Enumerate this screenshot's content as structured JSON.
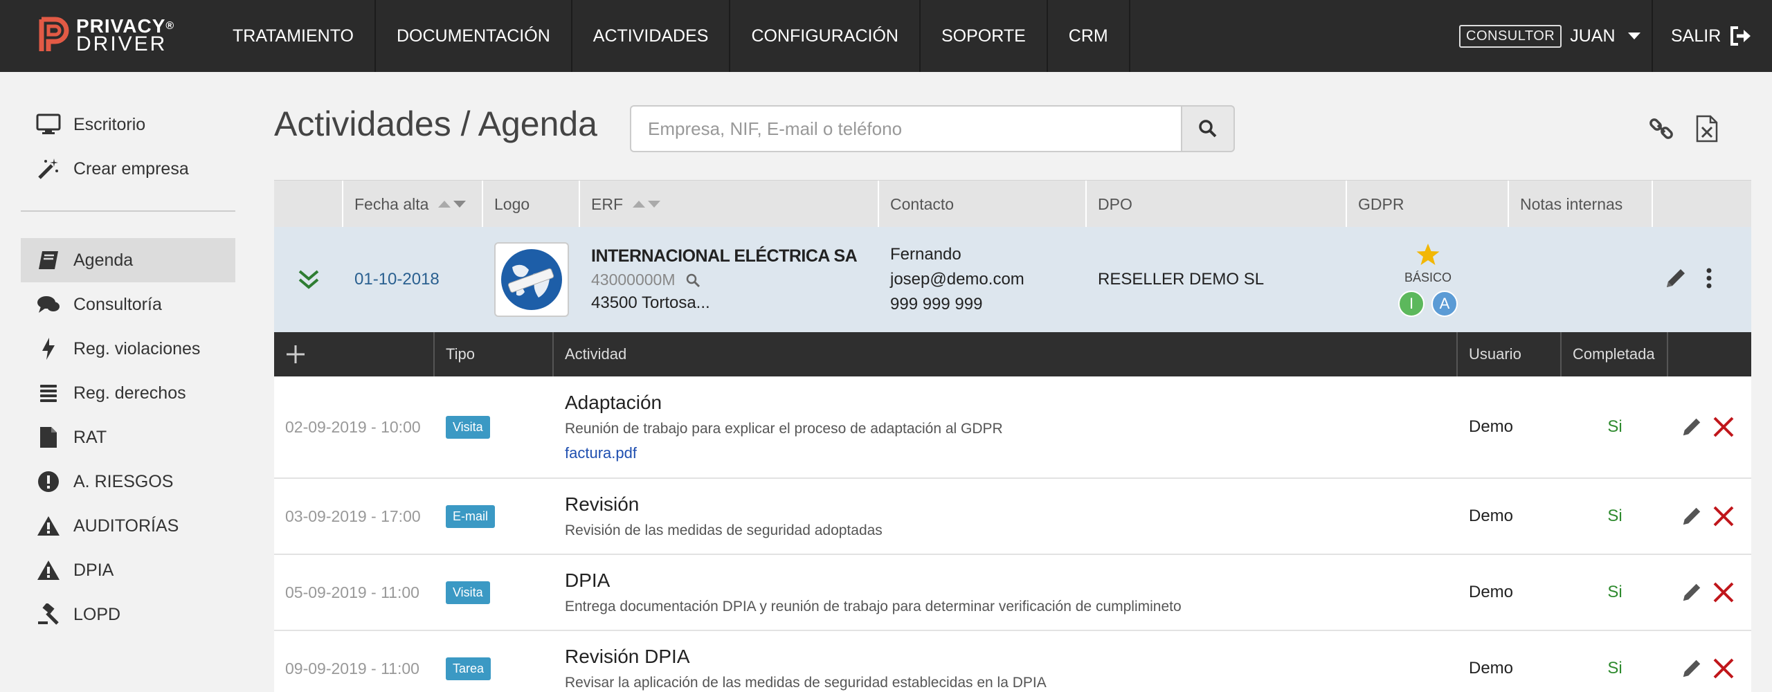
{
  "brand": {
    "line1": "PRIVACY",
    "line2": "DRIVER",
    "registered": "®"
  },
  "nav": {
    "items": [
      "TRATAMIENTO",
      "DOCUMENTACIÓN",
      "ACTIVIDADES",
      "CONFIGURACIÓN",
      "SOPORTE",
      "CRM"
    ],
    "role": "CONSULTOR",
    "user": "JUAN",
    "logout": "SALIR"
  },
  "sidebar": {
    "top": [
      {
        "label": "Escritorio",
        "icon": "monitor-icon"
      },
      {
        "label": "Crear empresa",
        "icon": "magic-wand-icon"
      }
    ],
    "items": [
      {
        "label": "Agenda",
        "icon": "book-icon",
        "active": true
      },
      {
        "label": "Consultoría",
        "icon": "chat-icon"
      },
      {
        "label": "Reg. violaciones",
        "icon": "bolt-icon"
      },
      {
        "label": "Reg. derechos",
        "icon": "list-icon"
      },
      {
        "label": "RAT",
        "icon": "file-icon"
      },
      {
        "label": "A. RIESGOS",
        "icon": "alert-circle-icon"
      },
      {
        "label": "AUDITORÍAS",
        "icon": "warning-icon"
      },
      {
        "label": "DPIA",
        "icon": "warning-icon"
      },
      {
        "label": "LOPD",
        "icon": "gavel-icon"
      }
    ]
  },
  "page": {
    "title": "Actividades / Agenda",
    "search_placeholder": "Empresa, NIF, E-mail o teléfono"
  },
  "companies": {
    "columns": [
      "Fecha alta",
      "Logo",
      "ERF",
      "Contacto",
      "DPO",
      "GDPR",
      "Notas internas"
    ],
    "row": {
      "date": "01-10-2018",
      "name": "INTERNACIONAL ELÉCTRICA SA",
      "nif": "43000000M",
      "address": "43500 Tortosa...",
      "contact_name": "Fernando",
      "contact_email": "josep@demo.com",
      "contact_phone": "999 999 999",
      "dpo": "RESELLER DEMO SL",
      "gdpr_level": "BÁSICO",
      "badges": [
        {
          "letter": "I",
          "color": "#5cb85c"
        },
        {
          "letter": "A",
          "color": "#5b9bd5"
        }
      ]
    }
  },
  "activities": {
    "columns": [
      "Tipo",
      "Actividad",
      "Usuario",
      "Completada"
    ],
    "rows": [
      {
        "date": "02-09-2019 - 10:00",
        "type": "Visita",
        "title": "Adaptación",
        "desc": "Reunión de trabajo para explicar el proceso de adaptación al GDPR",
        "file": "factura.pdf",
        "user": "Demo",
        "done": "Si"
      },
      {
        "date": "03-09-2019 - 17:00",
        "type": "E-mail",
        "title": "Revisión",
        "desc": "Revisión de las medidas de seguridad adoptadas",
        "user": "Demo",
        "done": "Si"
      },
      {
        "date": "05-09-2019 - 11:00",
        "type": "Visita",
        "title": "DPIA",
        "desc": "Entrega documentación DPIA y reunión de trabajo para determinar verificación de cumplimineto",
        "user": "Demo",
        "done": "Si"
      },
      {
        "date": "09-09-2019 - 11:00",
        "type": "Tarea",
        "title": "Revisión DPIA",
        "desc": "Revisar la aplicación de las medidas de seguridad establecidas en la DPIA",
        "user": "Demo",
        "done": "Si"
      }
    ]
  },
  "colors": {
    "nav_bg": "#2b2b2b",
    "tag": "#3b99c4",
    "delete": "#c0161b",
    "done": "#2e8a2e",
    "row_highlight": "#dde6ee"
  }
}
